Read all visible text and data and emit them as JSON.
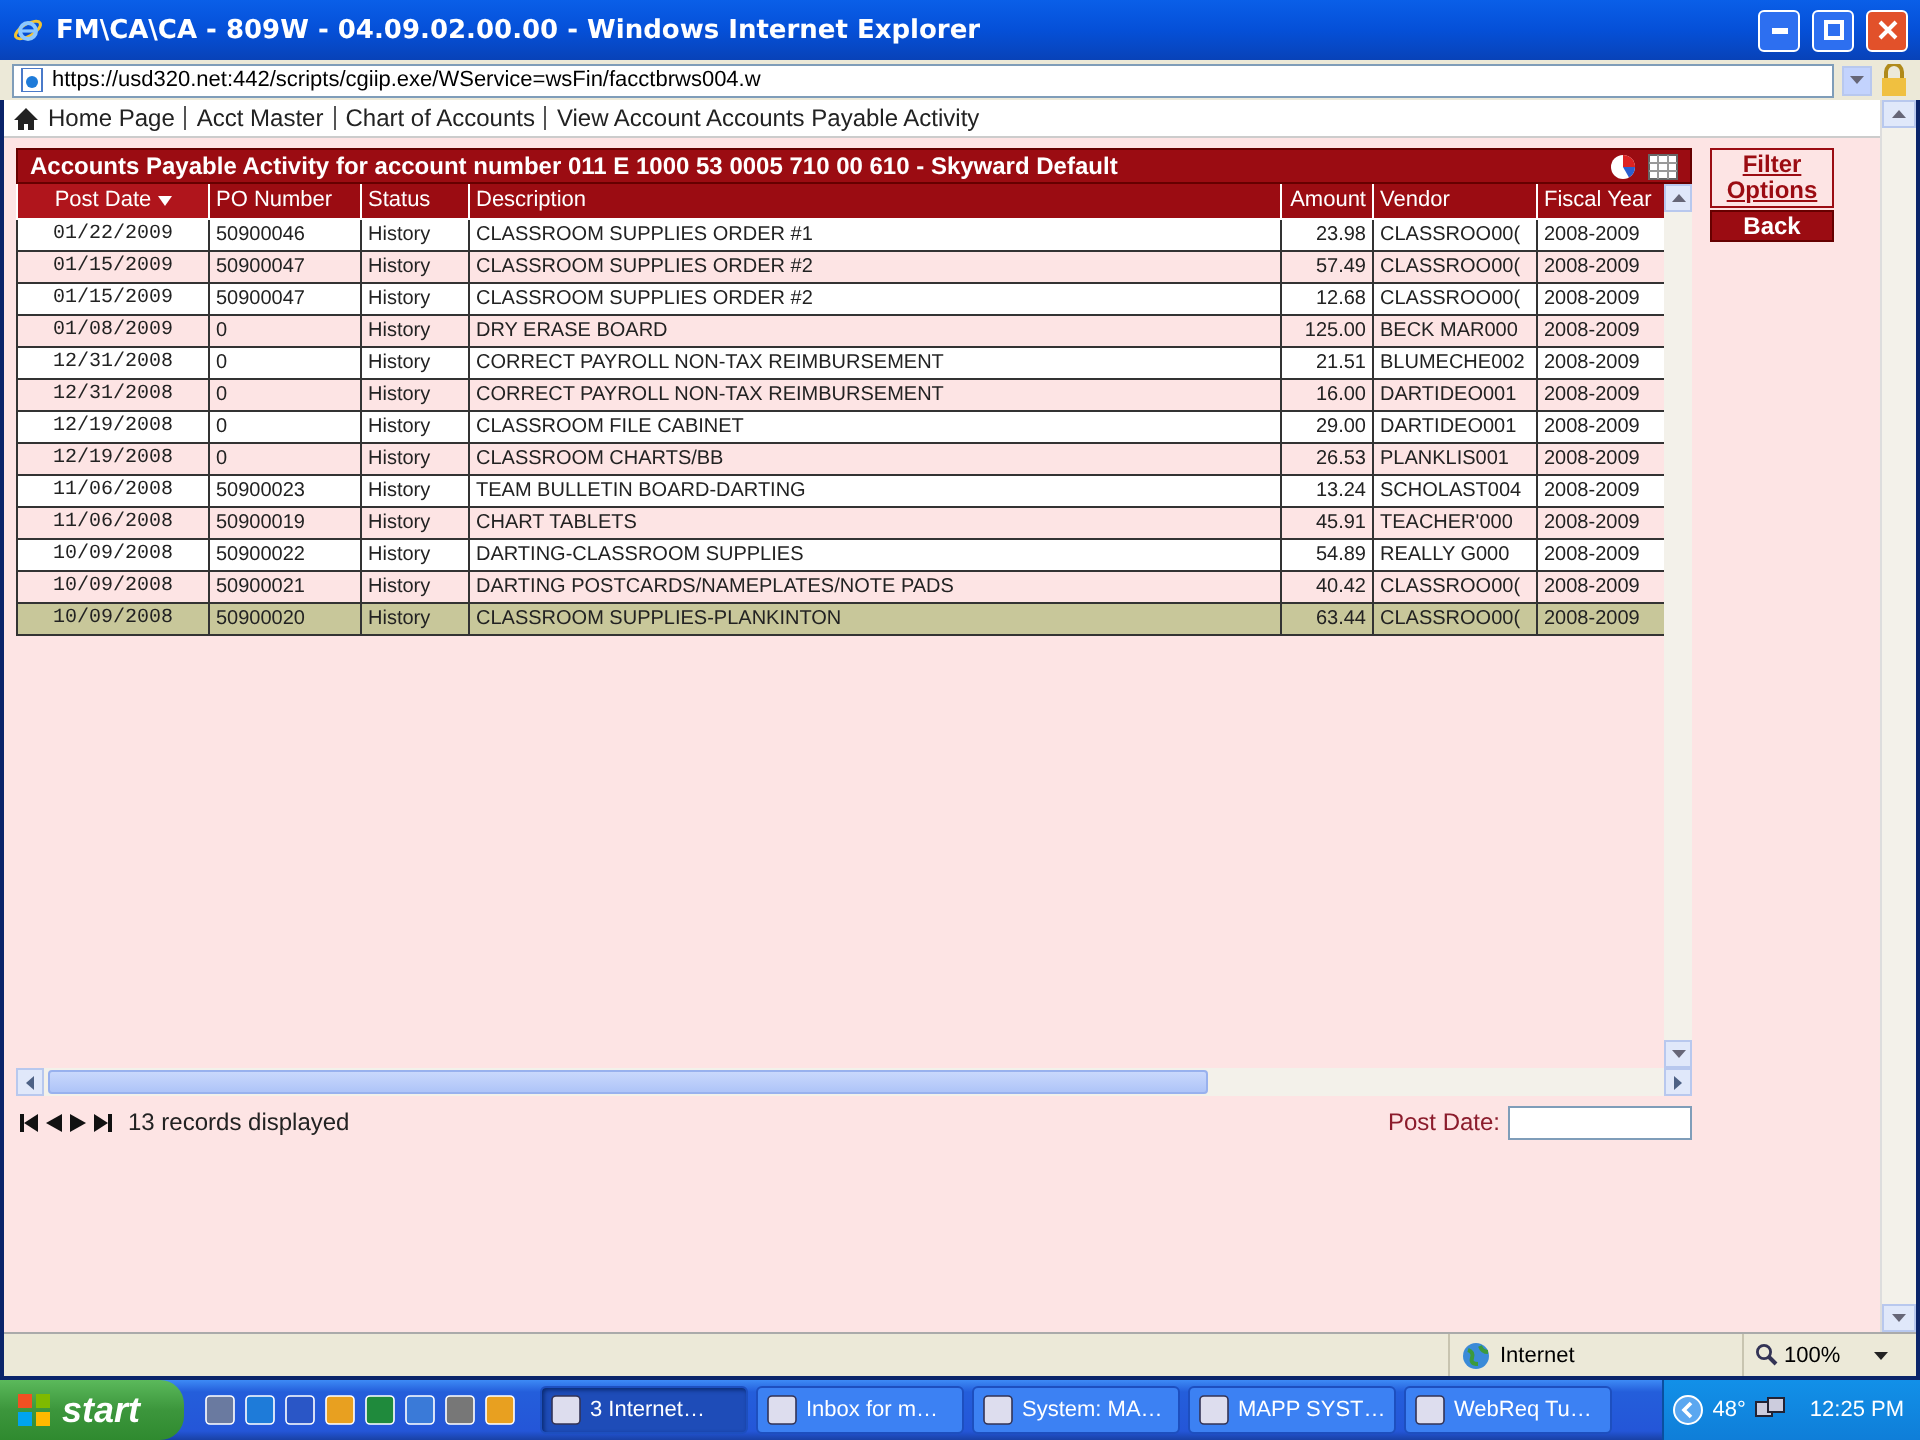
{
  "window": {
    "title": "FM\\CA\\CA - 809W - 04.09.02.00.00 - Windows Internet Explorer"
  },
  "address_bar": {
    "url": "https://usd320.net:442/scripts/cgiip.exe/WService=wsFin/facctbrws004.w"
  },
  "breadcrumb": [
    "Home Page",
    "Acct Master",
    "Chart of Accounts",
    "View Account Accounts Payable Activity"
  ],
  "grid": {
    "title": "Accounts Payable Activity for account number 011 E 1000 53 0005 710 00 610 - Skyward Default",
    "columns": [
      {
        "label": "Post Date",
        "kind": "date",
        "sorted": true
      },
      {
        "label": "PO Number",
        "kind": "text",
        "sorted": false
      },
      {
        "label": "Status",
        "kind": "text",
        "sorted": false
      },
      {
        "label": "Description",
        "kind": "text",
        "sorted": false
      },
      {
        "label": "Amount",
        "kind": "number",
        "sorted": false
      },
      {
        "label": "Vendor",
        "kind": "text",
        "sorted": false
      },
      {
        "label": "Fiscal Year",
        "kind": "text",
        "sorted": false
      }
    ],
    "rows": [
      {
        "cells": [
          "01/22/2009",
          "50900046",
          "History",
          "CLASSROOM SUPPLIES ORDER #1",
          "23.98",
          "CLASSROO00(",
          "2008-2009"
        ],
        "selected": false
      },
      {
        "cells": [
          "01/15/2009",
          "50900047",
          "History",
          "CLASSROOM SUPPLIES ORDER #2",
          "57.49",
          "CLASSROO00(",
          "2008-2009"
        ],
        "selected": false
      },
      {
        "cells": [
          "01/15/2009",
          "50900047",
          "History",
          "CLASSROOM SUPPLIES ORDER #2",
          "12.68",
          "CLASSROO00(",
          "2008-2009"
        ],
        "selected": false
      },
      {
        "cells": [
          "01/08/2009",
          "0",
          "History",
          "DRY ERASE BOARD",
          "125.00",
          "BECK MAR000",
          "2008-2009"
        ],
        "selected": false
      },
      {
        "cells": [
          "12/31/2008",
          "0",
          "History",
          "CORRECT PAYROLL NON-TAX REIMBURSEMENT",
          "21.51",
          "BLUMECHE002",
          "2008-2009"
        ],
        "selected": false
      },
      {
        "cells": [
          "12/31/2008",
          "0",
          "History",
          "CORRECT PAYROLL NON-TAX REIMBURSEMENT",
          "16.00",
          "DARTIDEO001",
          "2008-2009"
        ],
        "selected": false
      },
      {
        "cells": [
          "12/19/2008",
          "0",
          "History",
          "CLASSROOM FILE CABINET",
          "29.00",
          "DARTIDEO001",
          "2008-2009"
        ],
        "selected": false
      },
      {
        "cells": [
          "12/19/2008",
          "0",
          "History",
          "CLASSROOM CHARTS/BB",
          "26.53",
          "PLANKLIS001",
          "2008-2009"
        ],
        "selected": false
      },
      {
        "cells": [
          "11/06/2008",
          "50900023",
          "History",
          "TEAM BULLETIN BOARD-DARTING",
          "13.24",
          "SCHOLAST004",
          "2008-2009"
        ],
        "selected": false
      },
      {
        "cells": [
          "11/06/2008",
          "50900019",
          "History",
          "CHART TABLETS",
          "45.91",
          "TEACHER'000",
          "2008-2009"
        ],
        "selected": false
      },
      {
        "cells": [
          "10/09/2008",
          "50900022",
          "History",
          "DARTING-CLASSROOM SUPPLIES",
          "54.89",
          "REALLY G000",
          "2008-2009"
        ],
        "selected": false
      },
      {
        "cells": [
          "10/09/2008",
          "50900021",
          "History",
          "DARTING POSTCARDS/NAMEPLATES/NOTE PADS",
          "40.42",
          "CLASSROO00(",
          "2008-2009"
        ],
        "selected": false
      },
      {
        "cells": [
          "10/09/2008",
          "50900020",
          "History",
          "CLASSROOM SUPPLIES-PLANKINTON",
          "63.44",
          "CLASSROO00(",
          "2008-2009"
        ],
        "selected": true
      }
    ],
    "record_count": "13 records displayed",
    "post_date_label": "Post Date:"
  },
  "side_buttons": [
    "Filter Options",
    "Back"
  ],
  "status_bar": {
    "zone": "Internet",
    "zoom": "100%"
  },
  "taskbar": {
    "start": "start",
    "tasks": [
      {
        "label": "3 Internet…",
        "selected": true
      },
      {
        "label": "Inbox for m…",
        "selected": false
      },
      {
        "label": "System: MA…",
        "selected": false
      },
      {
        "label": "MAPP SYST…",
        "selected": false
      },
      {
        "label": "WebReq Tu…",
        "selected": false
      }
    ],
    "tray_temp": "48°",
    "clock": "12:25 PM"
  }
}
